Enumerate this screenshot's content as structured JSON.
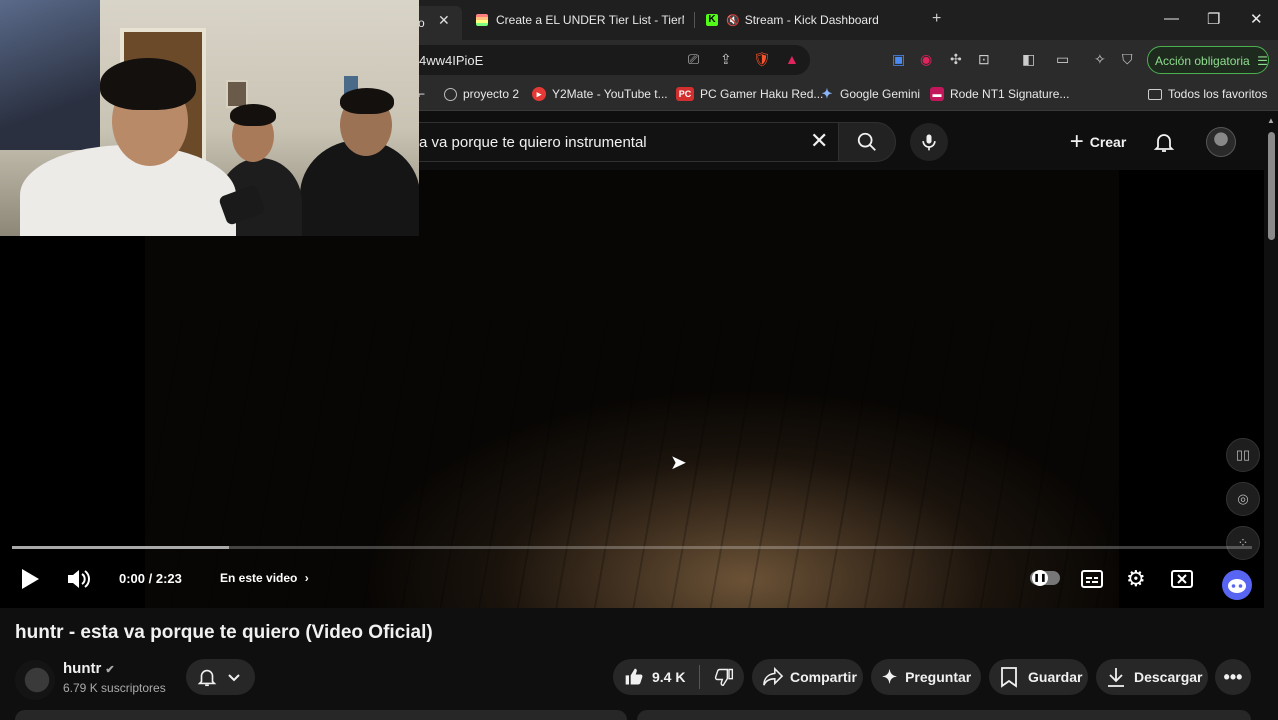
{
  "browser": {
    "tabs": [
      {
        "label": "o",
        "active": true
      },
      {
        "label": "Create a EL UNDER Tier List - TierMal",
        "active": false
      },
      {
        "label": "Stream - Kick Dashboard",
        "active": false
      }
    ],
    "address": {
      "url": "4ww4IPioE"
    },
    "accion_button": "Acción obligatoria",
    "bookmarks": [
      {
        "label": "proyecto 2",
        "icon": "globe-icon"
      },
      {
        "label": "Y2Mate - YouTube t...",
        "icon": "y2mate-icon"
      },
      {
        "label": "PC Gamer Haku Red...",
        "icon": "pc-icon"
      },
      {
        "label": "Google Gemini",
        "icon": "gemini-icon"
      },
      {
        "label": "Rode NT1 Signature...",
        "icon": "rode-icon"
      },
      {
        "label": "Todos los favoritos",
        "icon": "folder-icon"
      }
    ]
  },
  "youtube": {
    "search": {
      "value": "a va porque te quiero instrumental"
    },
    "create_label": "Crear",
    "player": {
      "time": "0:00 / 2:23",
      "chapter_label": "En este video",
      "progress": 0.0,
      "buffered": 0.175
    },
    "video": {
      "title": "huntr - esta va porque te quiero (Video Oficial)",
      "channel": "huntr",
      "subscribers": "6.79 K suscriptores",
      "likes": "9.4 K",
      "share": "Compartir",
      "ask": "Preguntar",
      "save": "Guardar",
      "download": "Descargar"
    }
  },
  "colors": {
    "accent_red": "#ff0000",
    "kick_green": "#53fc18",
    "accion_green": "#4caf50"
  }
}
